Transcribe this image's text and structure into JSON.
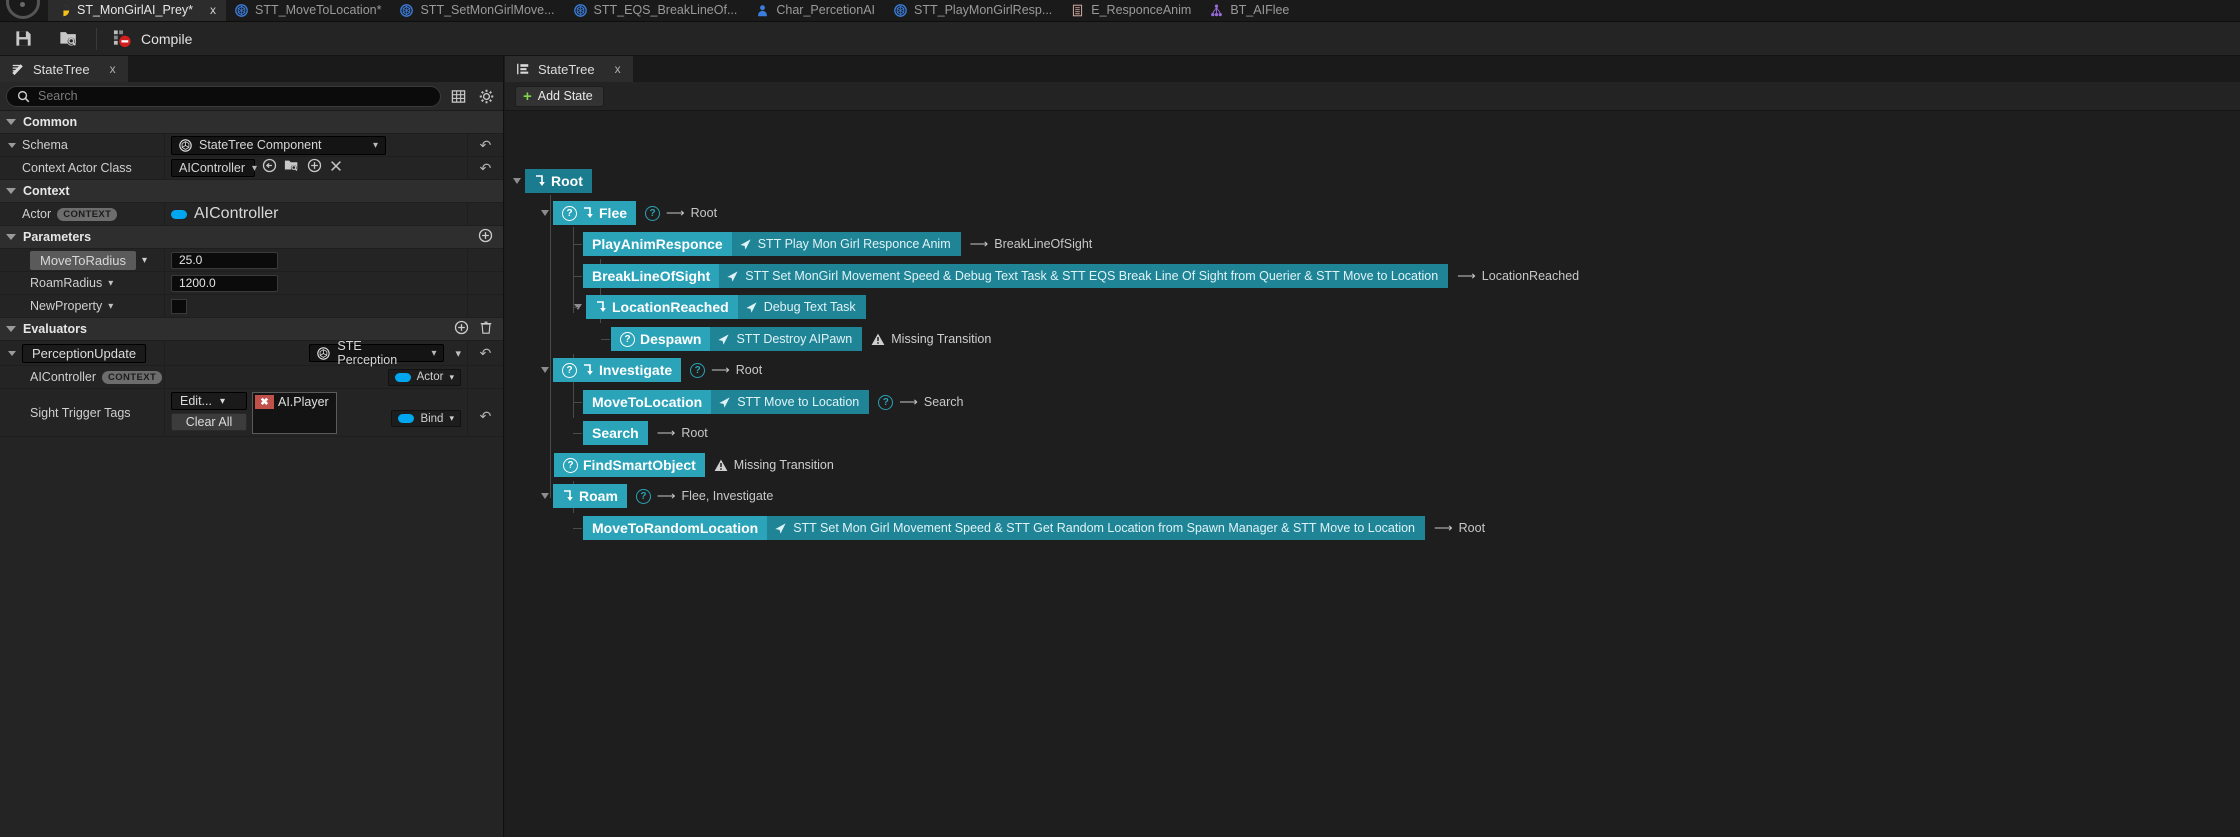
{
  "window": {
    "tabs": [
      {
        "label": "ST_MonGirlAI_Prey*",
        "icon": "statetree-asset-icon",
        "active": true,
        "closable": true
      },
      {
        "label": "STT_MoveToLocation*",
        "icon": "blueprint-icon",
        "active": false,
        "closable": false
      },
      {
        "label": "STT_SetMonGirlMove...",
        "icon": "blueprint-icon",
        "active": false,
        "closable": false
      },
      {
        "label": "STT_EQS_BreakLineOf...",
        "icon": "blueprint-icon",
        "active": false,
        "closable": false
      },
      {
        "label": "Char_PercetionAI",
        "icon": "character-icon",
        "active": false,
        "closable": false
      },
      {
        "label": "STT_PlayMonGirlResp...",
        "icon": "blueprint-icon",
        "active": false,
        "closable": false
      },
      {
        "label": "E_ResponceAnim",
        "icon": "enum-icon",
        "active": false,
        "closable": false
      },
      {
        "label": "BT_AIFlee",
        "icon": "behaviortree-icon",
        "active": false,
        "closable": false
      }
    ]
  },
  "toolbar": {
    "save_label": "Save",
    "browse_label": "Browse",
    "compile_label": "Compile"
  },
  "left_panel": {
    "dock_tab": {
      "label": "StateTree",
      "close": "x"
    },
    "search": {
      "placeholder": "Search",
      "value": ""
    },
    "sections": {
      "common": {
        "label": "Common",
        "schema": {
          "label": "Schema",
          "value": "StateTree Component",
          "context_actor_class": {
            "label": "Context Actor Class",
            "value": "AIController"
          }
        }
      },
      "context": {
        "label": "Context",
        "actor": {
          "label": "Actor",
          "badge": "CONTEXT",
          "value": "AIController"
        }
      },
      "parameters": {
        "label": "Parameters",
        "items": [
          {
            "name": "MoveToRadius",
            "value": "25.0",
            "type": "float",
            "selected": true
          },
          {
            "name": "RoamRadius",
            "value": "1200.0",
            "type": "float",
            "selected": false
          },
          {
            "name": "NewProperty",
            "value": "",
            "type": "color",
            "selected": false
          }
        ]
      },
      "evaluators": {
        "label": "Evaluators",
        "items": [
          {
            "name": "PerceptionUpdate",
            "class": "STE Perception",
            "properties": [
              {
                "label": "AIController",
                "badge": "CONTEXT",
                "value": ""
              },
              {
                "label": "Sight Trigger Tags",
                "edit_label": "Edit...",
                "clear_label": "Clear All",
                "tags": [
                  "AI.Player"
                ],
                "bind_label": "Bind"
              }
            ]
          }
        ]
      }
    }
  },
  "right_panel": {
    "dock_tab": {
      "label": "StateTree",
      "close": "x"
    },
    "add_state_label": "Add State",
    "tree": [
      {
        "id": "root",
        "name": "Root",
        "depth": 0,
        "kind": "root",
        "has_enter_icon": true,
        "has_condition": false,
        "tasks": [],
        "transition": "",
        "warning": "",
        "expanded": true
      },
      {
        "id": "flee",
        "name": "Flee",
        "depth": 1,
        "kind": "state",
        "has_enter_icon": true,
        "has_condition": true,
        "tasks": [],
        "transition": "Root",
        "warning": "",
        "expanded": true
      },
      {
        "id": "playanimresponce",
        "name": "PlayAnimResponce",
        "depth": 2,
        "kind": "leaf",
        "has_enter_icon": false,
        "has_condition": false,
        "tasks": [
          "STT Play Mon Girl Responce Anim"
        ],
        "transition": "BreakLineOfSight",
        "warning": ""
      },
      {
        "id": "breaklineofsight",
        "name": "BreakLineOfSight",
        "depth": 2,
        "kind": "leaf",
        "has_enter_icon": false,
        "has_condition": false,
        "tasks": [
          "STT Set MonGirl Movement Speed & Debug Text Task & STT EQS Break Line Of Sight from Querier & STT Move to Location"
        ],
        "transition": "LocationReached",
        "warning": ""
      },
      {
        "id": "locationreached",
        "name": "LocationReached",
        "depth": 2,
        "kind": "leaf",
        "has_enter_icon": true,
        "has_condition": false,
        "tasks": [
          "Debug Text Task"
        ],
        "transition": "",
        "warning": "",
        "expanded": true
      },
      {
        "id": "despawn",
        "name": "Despawn",
        "depth": 3,
        "kind": "leaf",
        "has_enter_icon": false,
        "has_condition": true,
        "tasks": [
          "STT Destroy AIPawn"
        ],
        "transition": "",
        "warning": "Missing Transition"
      },
      {
        "id": "investigate",
        "name": "Investigate",
        "depth": 1,
        "kind": "state",
        "has_enter_icon": true,
        "has_condition": true,
        "tasks": [],
        "transition": "Root",
        "warning": "",
        "expanded": true
      },
      {
        "id": "movetolocation",
        "name": "MoveToLocation",
        "depth": 2,
        "kind": "leaf",
        "has_enter_icon": false,
        "has_condition": false,
        "tasks": [
          "STT Move to Location"
        ],
        "transition": "Search",
        "transition_has_condition": true,
        "warning": ""
      },
      {
        "id": "search",
        "name": "Search",
        "depth": 2,
        "kind": "leaf",
        "has_enter_icon": false,
        "has_condition": false,
        "tasks": [],
        "transition": "Root",
        "warning": ""
      },
      {
        "id": "findsmartobject",
        "name": "FindSmartObject",
        "depth": 1,
        "kind": "state",
        "has_enter_icon": false,
        "has_condition": true,
        "tasks": [],
        "transition": "",
        "warning": "Missing Transition"
      },
      {
        "id": "roam",
        "name": "Roam",
        "depth": 1,
        "kind": "state",
        "has_enter_icon": true,
        "has_condition": true,
        "tasks": [],
        "transition": "Flee, Investigate",
        "warning": "",
        "expanded": true
      },
      {
        "id": "movetorandomlocation",
        "name": "MoveToRandomLocation",
        "depth": 2,
        "kind": "leaf",
        "has_enter_icon": false,
        "has_condition": false,
        "tasks": [
          "STT Set Mon Girl Movement Speed & STT Get Random Location from Spawn Manager & STT Move to Location"
        ],
        "transition": "Root",
        "warning": ""
      }
    ]
  },
  "colors": {
    "accent_teal": "#2ba3b8",
    "root_teal": "#1b7b8f",
    "task_teal": "#1f8496",
    "green_plus": "#7fd44a",
    "blue_pin": "#00a6f0",
    "red_tag": "#c0504a",
    "panel_bg": "#242424",
    "tree_bg": "#1e1e1e"
  }
}
